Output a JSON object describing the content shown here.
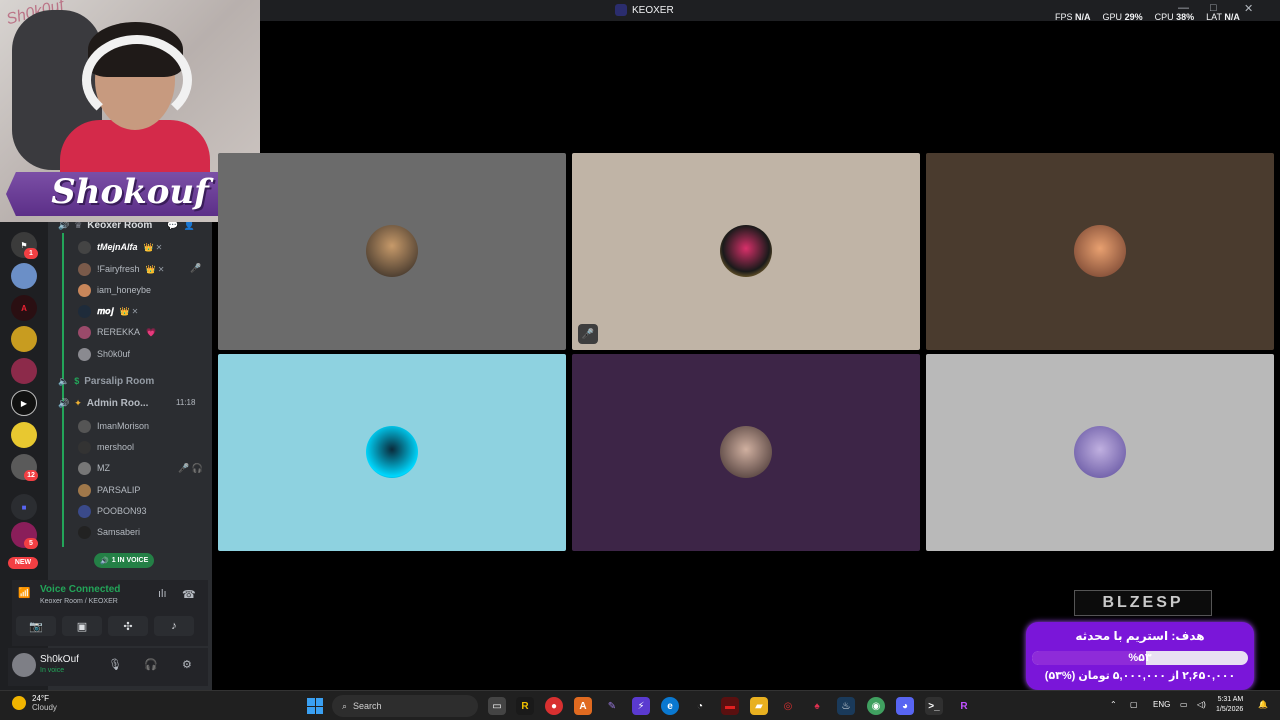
{
  "window": {
    "title": "KEOXER",
    "controls": [
      "—",
      "□",
      "✕"
    ]
  },
  "stats": [
    {
      "label": "FPS",
      "value": "N/A"
    },
    {
      "label": "GPU",
      "value": "29%"
    },
    {
      "label": "CPU",
      "value": "38%"
    },
    {
      "label": "LAT",
      "value": "N/A"
    }
  ],
  "webcam": {
    "banner_text": "Shokouf",
    "watermark": "Sh0k0uf"
  },
  "servers": {
    "badges": [
      "1",
      "12",
      "5"
    ],
    "new_label": "NEW"
  },
  "channels": {
    "keoxer_room": "Keoxer Room",
    "parsalip_room": "Parsalip Room",
    "admin_room": "Admin Roo...",
    "admin_room_time": "11:18",
    "keoxer_users": [
      {
        "name": "tMejnAlfa",
        "tags": "👑 ✕"
      },
      {
        "name": "!Fairyfresh",
        "tags": "👑 ✕"
      },
      {
        "name": "iam_honeybe",
        "tags": ""
      },
      {
        "name": "𝒎𝒐𝒋",
        "tags": "👑 ✕"
      },
      {
        "name": "REREKKA",
        "tags": "💗"
      },
      {
        "name": "Sh0k0uf",
        "tags": ""
      }
    ],
    "admin_users": [
      {
        "name": "ImanMorison"
      },
      {
        "name": "mershool"
      },
      {
        "name": "MZ"
      },
      {
        "name": "PARSALIP"
      },
      {
        "name": "POOBON93"
      },
      {
        "name": "Samsaberi"
      }
    ],
    "in_voice_label": "1 IN VOICE"
  },
  "voice": {
    "status": "Voice Connected",
    "room": "Keoxer Room / KEOXER"
  },
  "user": {
    "name": "Sh0kOuf",
    "status": "In voice"
  },
  "tiles": [
    {
      "bg": "#6b6b6b",
      "muted": false
    },
    {
      "bg": "#c0b4a6",
      "muted": true
    },
    {
      "bg": "#4a3b2e",
      "muted": false
    },
    {
      "bg": "#8ed2e0",
      "muted": false
    },
    {
      "bg": "#3d2547",
      "muted": false
    },
    {
      "bg": "#b9b9b9",
      "muted": false
    }
  ],
  "widget": {
    "logo": "BLZESP",
    "goal_title": "هدف: استریم با محدثه",
    "percent_text": "%۵۳",
    "percent_value": 53,
    "detail": "۲,۶۵۰,۰۰۰ از ۵,۰۰۰,۰۰۰ تومان (%۵۳)"
  },
  "taskbar": {
    "temp": "24°F",
    "weather": "Cloudy",
    "search_label": "Search",
    "lang": "ENG",
    "time": "5:31 AM",
    "date": "1/5/2026"
  }
}
